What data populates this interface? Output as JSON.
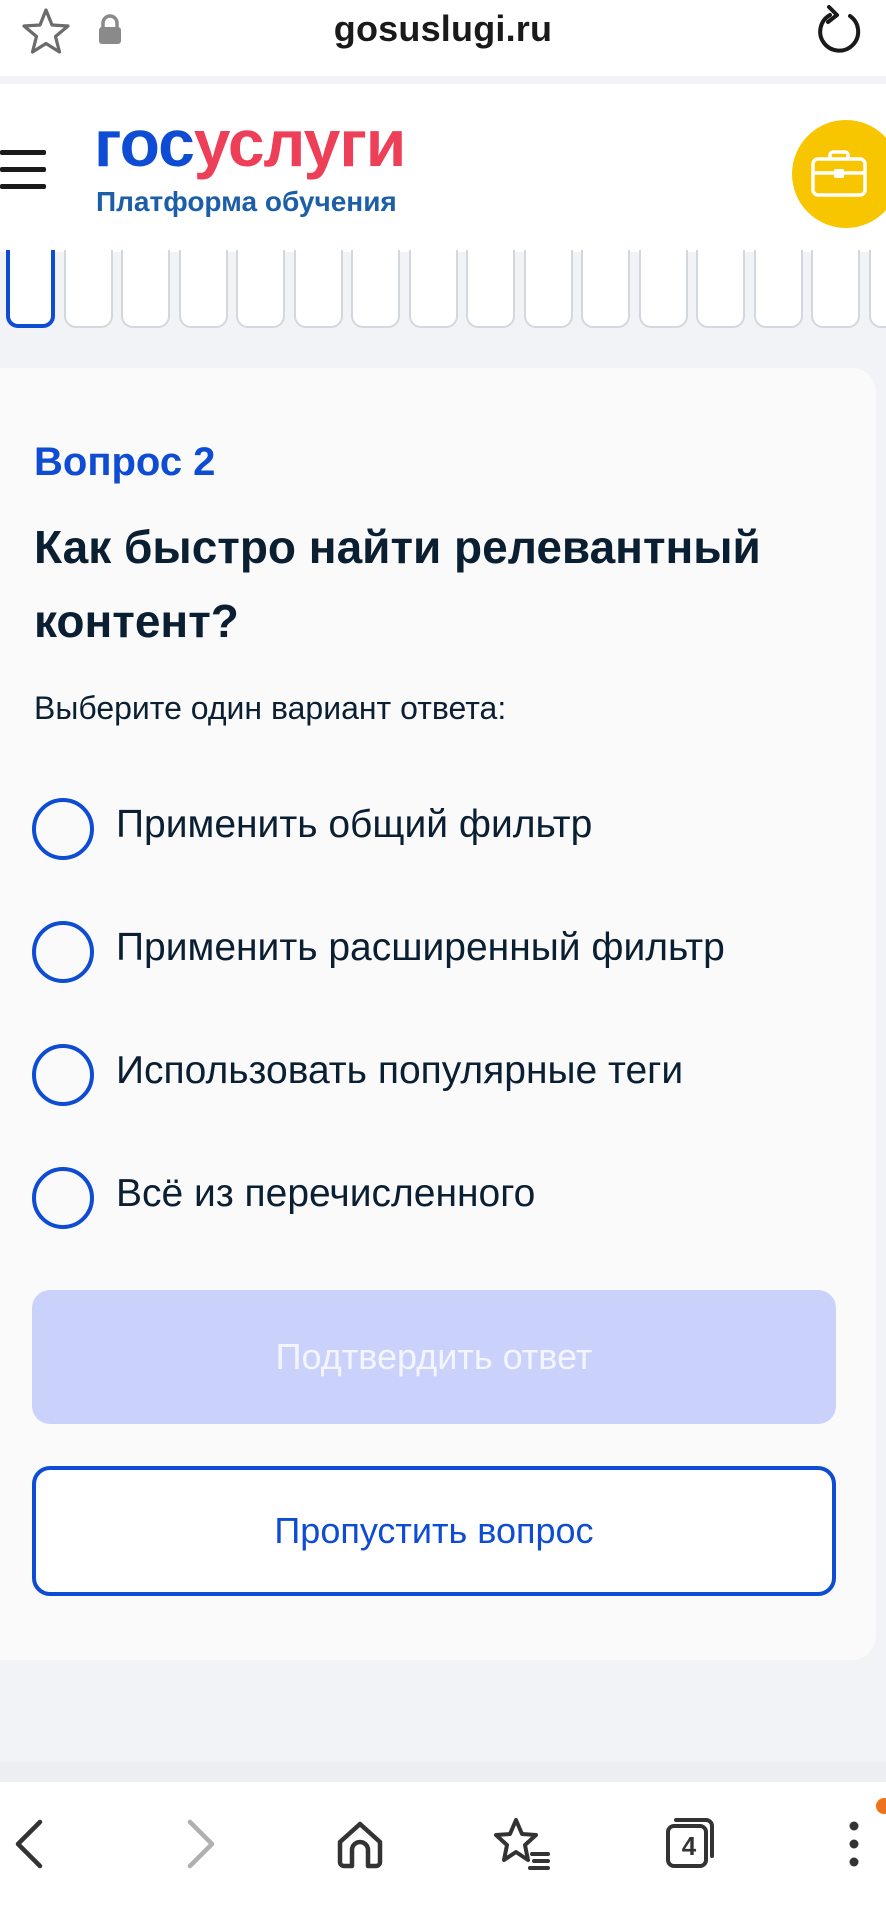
{
  "browser": {
    "url": "gosuslugi.ru",
    "tab_count": "4"
  },
  "header": {
    "logo_part1": "гос",
    "logo_part2": "услуги",
    "logo_subtitle": "Платформа обучения"
  },
  "progress": {
    "current_index": 1
  },
  "question": {
    "number": "Вопрос 2",
    "title": "Как быстро найти релевантный контент?",
    "hint": "Выберите один вариант ответа:",
    "options": [
      {
        "label": "Применить общий фильтр",
        "selected": false
      },
      {
        "label": "Применить расширенный фильтр",
        "selected": false
      },
      {
        "label": "Использовать популярные теги",
        "selected": false
      },
      {
        "label": "Всё из перечисленного",
        "selected": false
      }
    ]
  },
  "actions": {
    "confirm_label": "Подтвердить ответ",
    "skip_label": "Пропустить вопрос"
  },
  "colors": {
    "brand_blue": "#0d4cd3",
    "brand_red": "#ee3f58",
    "briefcase_yellow": "#f7c600",
    "confirm_disabled": "#cad2fb"
  },
  "icons": {
    "browser": [
      "star-icon",
      "lock-icon",
      "reload-icon"
    ],
    "header": [
      "hamburger-menu-icon",
      "briefcase-icon"
    ],
    "bottom_nav": [
      "back-icon",
      "forward-icon",
      "home-icon",
      "favorites-icon",
      "tabs-icon",
      "more-icon"
    ]
  }
}
